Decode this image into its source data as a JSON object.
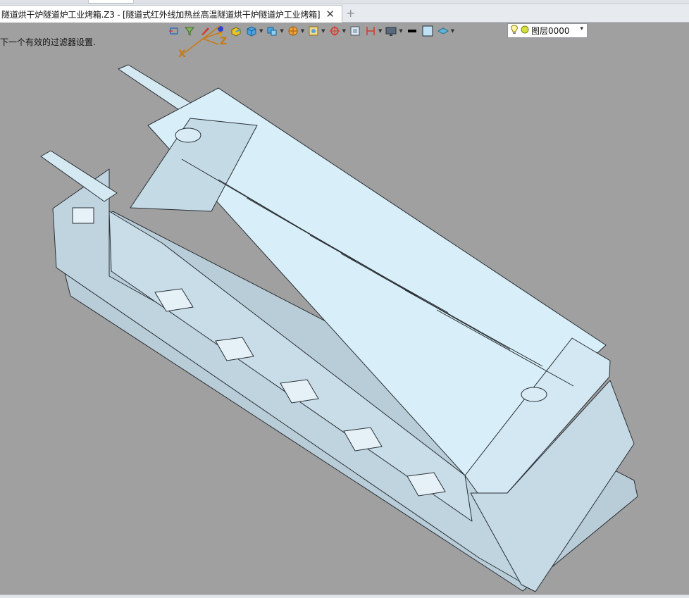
{
  "window": {
    "tab_title": "隧道烘干炉隧道炉工业烤箱.Z3 - [隧道式红外线加热丝高温隧道烘干炉隧道炉工业烤箱]",
    "tab_close": "✕",
    "tab_add": "+"
  },
  "status": {
    "message": "下一个有效的过滤器设置."
  },
  "toolbar": {
    "icons": [
      "view-icon",
      "filter-icon",
      "pencil-icon",
      "xyz-icon",
      "box-color-icon",
      "cube-icon",
      "cube-split-icon",
      "sphere-wheel-icon",
      "zoom-fit-icon",
      "move-icon",
      "frame-icon",
      "dimension-icon",
      "monitor-icon",
      "line-color-icon",
      "fill-color-icon",
      "layers-icon"
    ],
    "layer_value": "图层0000",
    "layer_dropdown": "▾"
  },
  "axis": {
    "x_label": "X",
    "z_label": "Z"
  },
  "colors": {
    "background": "#a0a0a0",
    "model_fill": "#cfe7f3",
    "model_line": "#2a2f35",
    "accent": "#d23a2a"
  }
}
